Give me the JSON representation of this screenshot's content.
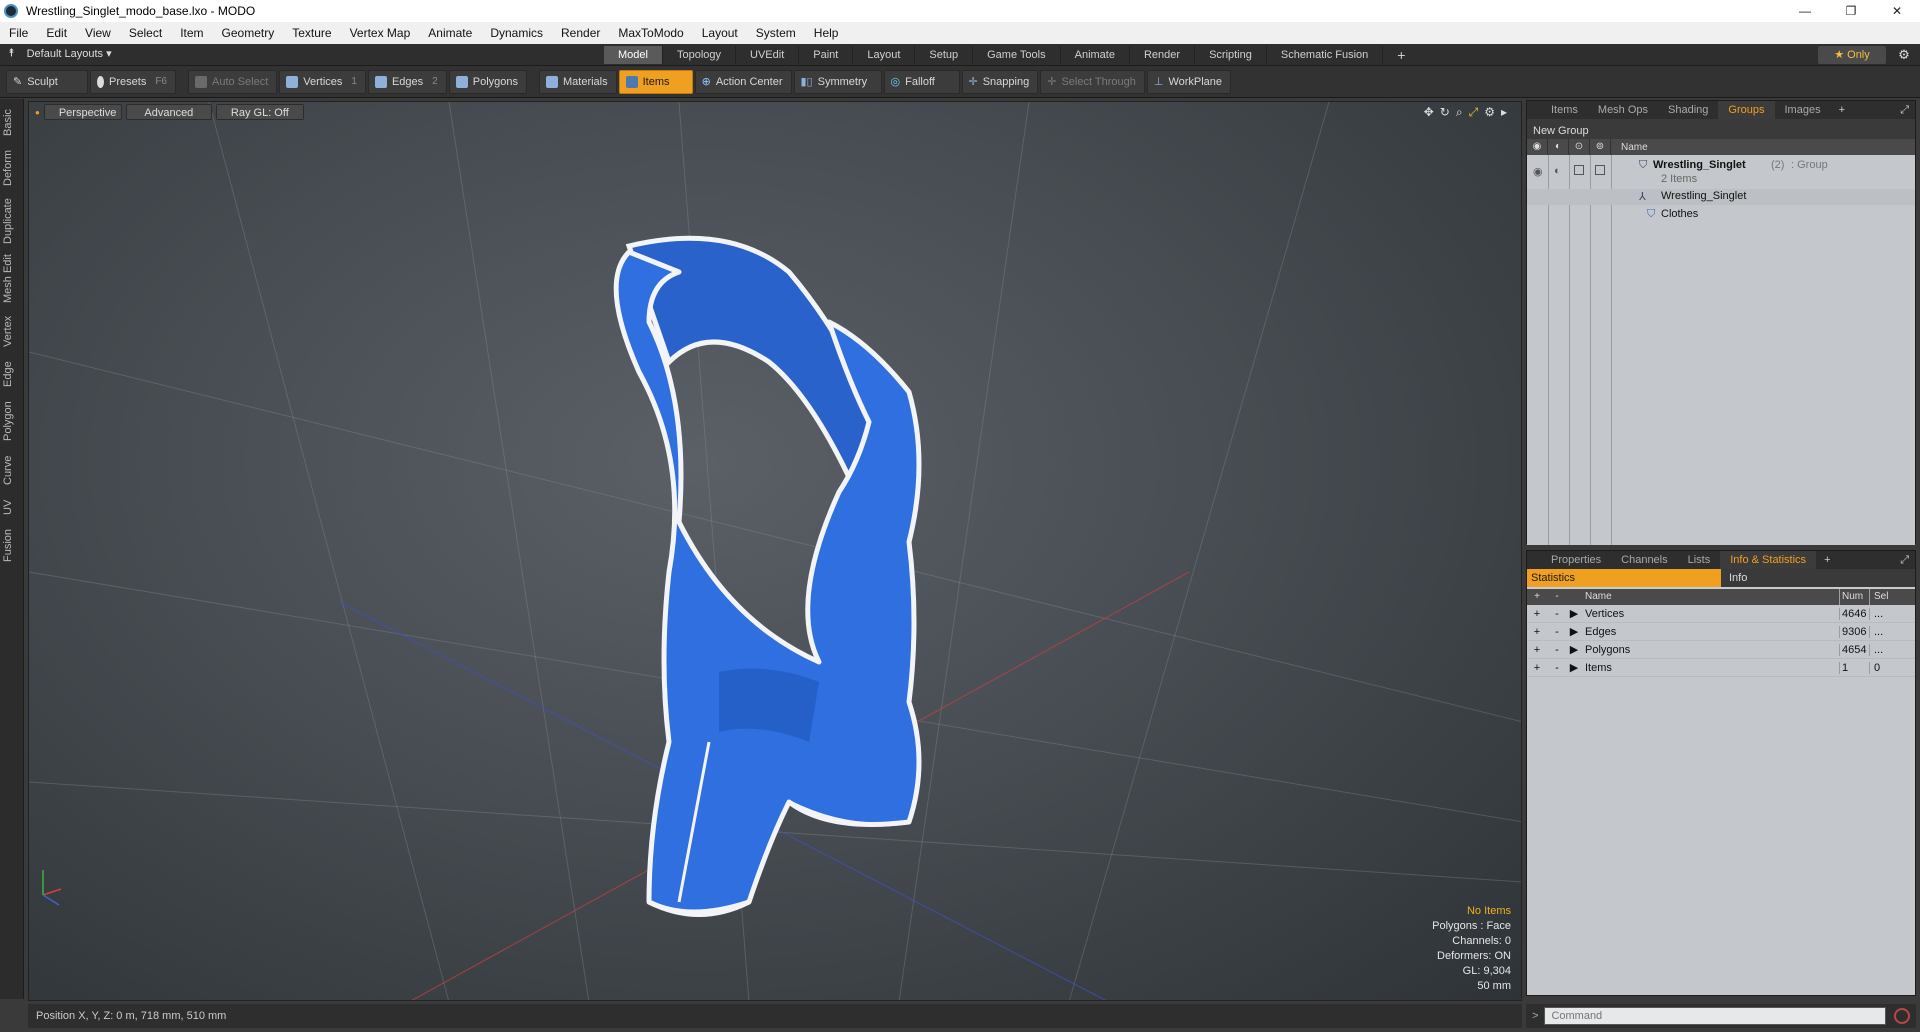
{
  "window": {
    "title": "Wrestling_Singlet_modo_base.lxo - MODO",
    "minimize": "—",
    "maximize": "❐",
    "close": "✕"
  },
  "menu": [
    "File",
    "Edit",
    "View",
    "Select",
    "Item",
    "Geometry",
    "Texture",
    "Vertex Map",
    "Animate",
    "Dynamics",
    "Render",
    "MaxToModo",
    "Layout",
    "System",
    "Help"
  ],
  "layoutbar": {
    "layouts_label": "Default Layouts ▾",
    "tabs": [
      "Model",
      "Topology",
      "UVEdit",
      "Paint",
      "Layout",
      "Setup",
      "Game Tools",
      "Animate",
      "Render",
      "Scripting",
      "Schematic Fusion"
    ],
    "active_tab": "Model",
    "add": "+",
    "only_label": "★  Only",
    "gear": "⚙"
  },
  "toolbar": {
    "sculpt": "Sculpt",
    "presets": "Presets",
    "presets_key": "F6",
    "auto_select": "Auto Select",
    "vertices": "Vertices",
    "vertices_key": "1",
    "edges": "Edges",
    "edges_key": "2",
    "polygons": "Polygons",
    "materials": "Materials",
    "items": "Items",
    "action_center": "Action Center",
    "symmetry": "Symmetry",
    "falloff": "Falloff",
    "snapping": "Snapping",
    "select_through": "Select Through",
    "workplane": "WorkPlane"
  },
  "left_tabs": [
    "Basic",
    "Deform",
    "Duplicate",
    "Mesh Edit",
    "Vertex",
    "Edge",
    "Polygon",
    "Curve",
    "UV",
    "Fusion"
  ],
  "viewport": {
    "perspective": "Perspective",
    "advanced": "Advanced",
    "raygl": "Ray GL: Off",
    "info": {
      "no_items": "No Items",
      "polygons": "Polygons : Face",
      "channels": "Channels: 0",
      "deformers": "Deformers: ON",
      "gl": "GL: 9,304",
      "scale": "50 mm"
    },
    "colors": {
      "garment": "#2f6fe0",
      "trim": "#f2f4f8"
    }
  },
  "status": {
    "position": "Position X, Y, Z:   0 m, 718 mm, 510 mm"
  },
  "groups_panel": {
    "tabs": [
      "Items",
      "Mesh Ops",
      "Shading",
      "Groups",
      "Images"
    ],
    "active_tab": "Groups",
    "new_group": "New Group",
    "name_header": "Name",
    "group_name": "Wrestling_Singlet",
    "group_count": "(2)",
    "group_type": ": Group",
    "group_items": "2 Items",
    "children": [
      "Wrestling_Singlet",
      "Clothes"
    ]
  },
  "stats_panel": {
    "tabs": [
      "Properties",
      "Channels",
      "Lists",
      "Info & Statistics"
    ],
    "active_tab": "Info & Statistics",
    "subtabs": [
      "Statistics",
      "Info"
    ],
    "headers": {
      "name": "Name",
      "num": "Num",
      "sel": "Sel"
    },
    "rows": [
      {
        "name": "Vertices",
        "num": "4646",
        "sel": "..."
      },
      {
        "name": "Edges",
        "num": "9306",
        "sel": "..."
      },
      {
        "name": "Polygons",
        "num": "4654",
        "sel": "..."
      },
      {
        "name": "Items",
        "num": "1",
        "sel": "0"
      }
    ]
  },
  "command": {
    "placeholder": "Command",
    "prompt": ">"
  }
}
